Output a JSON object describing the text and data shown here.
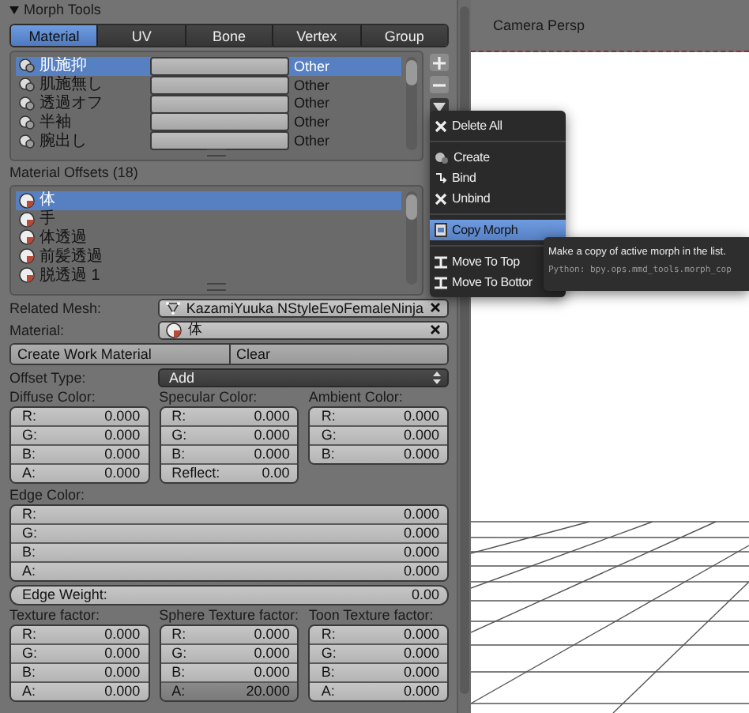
{
  "panel": {
    "title": "Morph Tools",
    "expanded": true
  },
  "tabs": [
    {
      "label": "Material",
      "selected": true
    },
    {
      "label": "UV",
      "selected": false
    },
    {
      "label": "Bone",
      "selected": false
    },
    {
      "label": "Vertex",
      "selected": false
    },
    {
      "label": "Group",
      "selected": false
    }
  ],
  "morphs": [
    {
      "name": "肌施抑",
      "category": "Other",
      "selected": true
    },
    {
      "name": "肌施無し",
      "category": "Other",
      "selected": false
    },
    {
      "name": "透過オフ",
      "category": "Other",
      "selected": false
    },
    {
      "name": "半袖",
      "category": "Other",
      "selected": false
    },
    {
      "name": "腕出し",
      "category": "Other",
      "selected": false
    }
  ],
  "offsets": {
    "title": "Material Offsets (18)",
    "rows": [
      {
        "name": "体",
        "selected": true
      },
      {
        "name": "手",
        "selected": false
      },
      {
        "name": "体透過",
        "selected": false
      },
      {
        "name": "前髪透過",
        "selected": false
      },
      {
        "name": "脱透過 1",
        "selected": false
      }
    ]
  },
  "related_mesh": {
    "label": "Related Mesh:",
    "value": "KazamiYuuka NStyleEvoFemaleNinja"
  },
  "material": {
    "label": "Material:",
    "value": "体"
  },
  "actions": [
    "Create Work Material",
    "Clear"
  ],
  "offset_type": {
    "label": "Offset Type:",
    "value": "Add"
  },
  "color_groups": [
    {
      "title": "Diffuse Color:",
      "fields": [
        {
          "label": "R:",
          "value": "0.000",
          "active": false
        },
        {
          "label": "G:",
          "value": "0.000",
          "active": false
        },
        {
          "label": "B:",
          "value": "0.000",
          "active": false
        },
        {
          "label": "A:",
          "value": "0.000",
          "active": false
        }
      ]
    },
    {
      "title": "Specular Color:",
      "fields": [
        {
          "label": "R:",
          "value": "0.000",
          "active": false
        },
        {
          "label": "G:",
          "value": "0.000",
          "active": false
        },
        {
          "label": "B:",
          "value": "0.000",
          "active": false
        },
        {
          "label": "Reflect:",
          "value": "0.00",
          "active": false
        }
      ]
    },
    {
      "title": "Ambient Color:",
      "fields": [
        {
          "label": "R:",
          "value": "0.000",
          "active": false
        },
        {
          "label": "G:",
          "value": "0.000",
          "active": false
        },
        {
          "label": "B:",
          "value": "0.000",
          "active": false
        }
      ]
    }
  ],
  "edge_color": {
    "title": "Edge Color:",
    "fields": [
      {
        "label": "R:",
        "value": "0.000",
        "active": false
      },
      {
        "label": "G:",
        "value": "0.000",
        "active": false
      },
      {
        "label": "B:",
        "value": "0.000",
        "active": false
      },
      {
        "label": "A:",
        "value": "0.000",
        "active": false
      }
    ]
  },
  "edge_weight": {
    "label": "Edge Weight:",
    "value": "0.00"
  },
  "texture_groups": [
    {
      "title": "Texture factor:",
      "fields": [
        {
          "label": "R:",
          "value": "0.000",
          "active": false
        },
        {
          "label": "G:",
          "value": "0.000",
          "active": false
        },
        {
          "label": "B:",
          "value": "0.000",
          "active": false
        },
        {
          "label": "A:",
          "value": "0.000",
          "active": false
        }
      ]
    },
    {
      "title": "Sphere Texture factor:",
      "fields": [
        {
          "label": "R:",
          "value": "0.000",
          "active": false
        },
        {
          "label": "G:",
          "value": "0.000",
          "active": false
        },
        {
          "label": "B:",
          "value": "0.000",
          "active": false
        },
        {
          "label": "A:",
          "value": "20.000",
          "active": true
        }
      ]
    },
    {
      "title": "Toon Texture factor:",
      "fields": [
        {
          "label": "R:",
          "value": "0.000",
          "active": false
        },
        {
          "label": "G:",
          "value": "0.000",
          "active": false
        },
        {
          "label": "B:",
          "value": "0.000",
          "active": false
        },
        {
          "label": "A:",
          "value": "0.000",
          "active": false
        }
      ]
    }
  ],
  "viewport": {
    "title": "Camera Persp"
  },
  "menu": {
    "groups": [
      [
        {
          "label": "Delete All",
          "kind": "delete",
          "selected": false
        }
      ],
      [
        {
          "label": "Create",
          "kind": "create",
          "selected": false
        },
        {
          "label": "Bind",
          "kind": "bind",
          "selected": false
        },
        {
          "label": "Unbind",
          "kind": "unbind",
          "selected": false
        }
      ],
      [
        {
          "label": "Copy Morph",
          "kind": "copy",
          "selected": true
        }
      ],
      [
        {
          "label": "Move To Top",
          "kind": "top",
          "selected": false
        },
        {
          "label": "Move To Bottor",
          "kind": "bottom",
          "selected": false
        }
      ]
    ]
  },
  "tooltip": {
    "text": "Make a copy of active morph in the list.",
    "python": "Python: bpy.ops.mmd_tools.morph_cop"
  }
}
